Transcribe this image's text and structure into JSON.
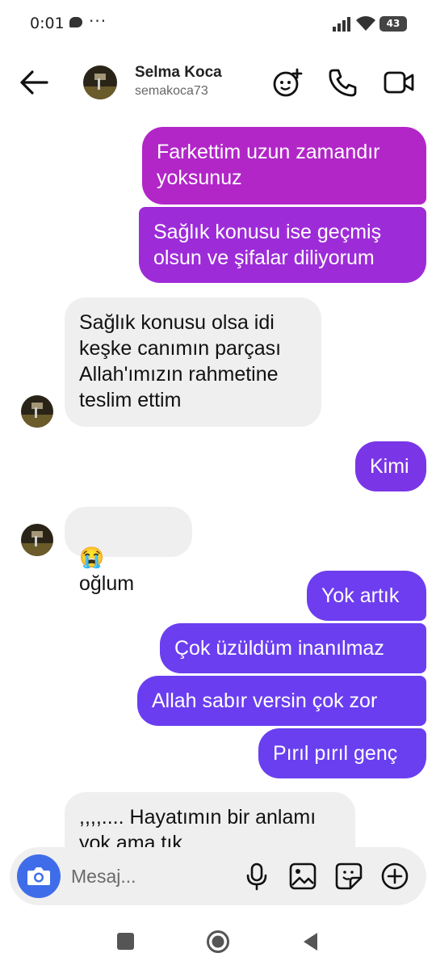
{
  "status": {
    "time": "0:01",
    "dots": "···",
    "battery": "43"
  },
  "header": {
    "name": "Selma Koca",
    "handle": "semakoca73"
  },
  "messages": [
    {
      "dir": "out",
      "text": "Farkettim uzun zamandır\nyoksunuz"
    },
    {
      "dir": "out",
      "text": "Sağlık konusu ise geçmiş\nolsun ve şifalar diliyorum"
    },
    {
      "dir": "in",
      "text": "Sağlık konusu olsa idi\nkeşke canımın parçası\nAllah'ımızın rahmetine\nteslim ettim"
    },
    {
      "dir": "out",
      "text": "Kimi"
    },
    {
      "dir": "in",
      "emoji": "😭",
      "text": "oğlum"
    },
    {
      "dir": "out",
      "text": "Yok artık"
    },
    {
      "dir": "out",
      "text": "Çok üzüldüm inanılmaz"
    },
    {
      "dir": "out",
      "text": "Allah sabır versin çok zor"
    },
    {
      "dir": "out",
      "text": "Pırıl pırıl genç"
    },
    {
      "dir": "in",
      "text": ",,,,.... Hayatımın bir anlamı\nyok ama tık"
    }
  ],
  "composer": {
    "placeholder": "Mesaj..."
  },
  "colors": {
    "gradient_top": "#b025c9",
    "gradient_mid": "#9e2ad9",
    "gradient_bottom": "#6a3ef0",
    "incoming_bg": "#efefef",
    "camera_bg": "#3f6dea"
  },
  "icons": [
    "back-arrow-icon",
    "add-user-icon",
    "phone-icon",
    "video-icon",
    "camera-icon",
    "microphone-icon",
    "image-icon",
    "sticker-icon",
    "plus-icon"
  ]
}
